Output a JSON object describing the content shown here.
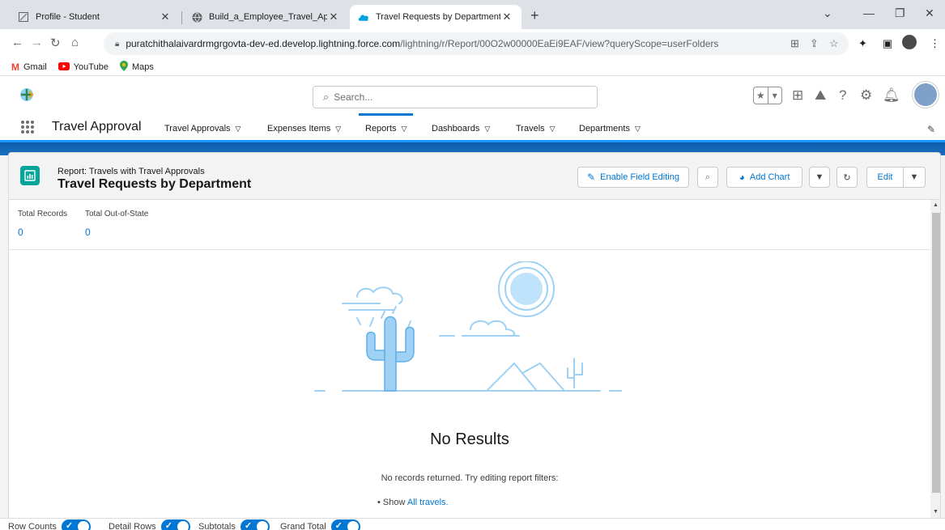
{
  "browser": {
    "tabs": [
      {
        "title": "Profile - Student"
      },
      {
        "title": "Build_a_Employee_Travel_Approv"
      },
      {
        "title": "Travel Requests by Department |"
      }
    ],
    "url_main": "puratchithalaivardrmgrgovta-dev-ed.develop.lightning.force.com",
    "url_path": "/lightning/r/Report/00O2w00000EaEi9EAF/view?queryScope=userFolders",
    "bookmarks": [
      {
        "label": "Gmail",
        "icon": "gmail-icon"
      },
      {
        "label": "YouTube",
        "icon": "youtube-icon"
      },
      {
        "label": "Maps",
        "icon": "maps-icon"
      }
    ]
  },
  "header": {
    "search_placeholder": "Search..."
  },
  "appnav": {
    "app_name": "Travel Approval",
    "items": [
      {
        "label": "Travel Approvals"
      },
      {
        "label": "Expenses Items"
      },
      {
        "label": "Reports"
      },
      {
        "label": "Dashboards"
      },
      {
        "label": "Travels"
      },
      {
        "label": "Departments"
      }
    ]
  },
  "report": {
    "breadcrumb": "Report: Travels with Travel Approvals",
    "title": "Travel Requests by Department",
    "buttons": {
      "enable_field_editing": "Enable Field Editing",
      "add_chart": "Add Chart",
      "edit": "Edit"
    },
    "metrics": [
      {
        "label": "Total Records",
        "value": "0"
      },
      {
        "label": "Total Out-of-State",
        "value": "0"
      }
    ],
    "empty": {
      "heading": "No Results",
      "hint": "No records returned. Try editing report filters:",
      "show_prefix": "• Show ",
      "show_link": "All travels."
    }
  },
  "footer": {
    "toggles": [
      {
        "label": "Row Counts"
      },
      {
        "label": "Detail Rows"
      },
      {
        "label": "Subtotals"
      },
      {
        "label": "Grand Total"
      }
    ]
  },
  "colors": {
    "brand_blue": "#0176d3",
    "report_icon": "#06a59a",
    "illustration": "#9fd1f5"
  }
}
